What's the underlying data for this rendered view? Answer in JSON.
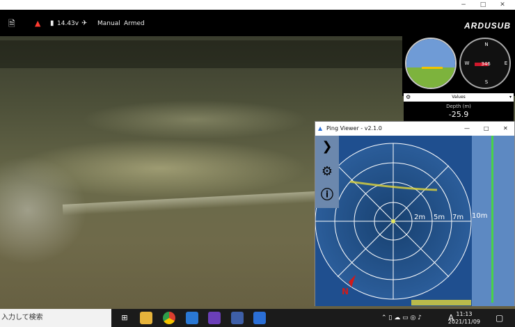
{
  "window": {
    "controls": [
      "−",
      "□"
    ]
  },
  "toolbar": {
    "voltage": "14.43v",
    "mode": "Manual",
    "armed_state": "Armed",
    "logo": "ARDUSUB"
  },
  "instruments": {
    "compass_labels": {
      "north": "N",
      "east": "E",
      "south": "S",
      "west": "W"
    },
    "heading": "346"
  },
  "depth_panel": {
    "selector_label": "Values",
    "label": "Depth (m)",
    "value": "-25.9"
  },
  "ping_viewer": {
    "title": "Ping Viewer - v2.1.0",
    "ranges": [
      "2m",
      "5m",
      "7m",
      "10m"
    ],
    "north_label": "N",
    "colors": {
      "background": "#1f4f8f",
      "accent": "#e0d43a",
      "depth_trace": "#49d24a"
    }
  },
  "taskbar": {
    "search_placeholder": "入力して検索",
    "time": "11:13",
    "date": "2021/11/09",
    "ime": "A"
  }
}
